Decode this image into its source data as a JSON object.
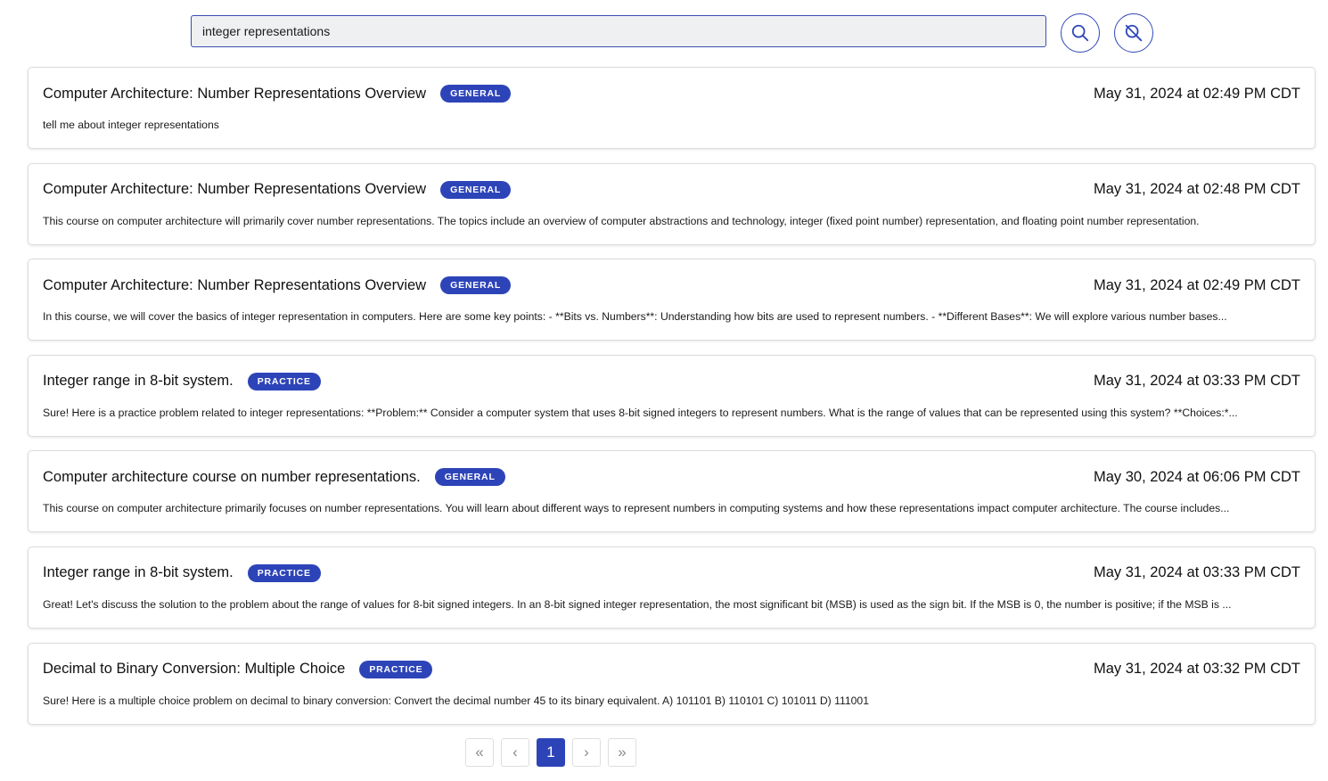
{
  "search": {
    "value": "integer representations"
  },
  "colors": {
    "accent": "#2d44b8",
    "input_bg": "#eff0f2",
    "card_border": "#dcdcdc"
  },
  "icons": {
    "search_button": "search-icon",
    "clear_button": "search-off-icon"
  },
  "results": [
    {
      "title": "Computer Architecture: Number Representations Overview",
      "badge": "GENERAL",
      "date": "May 31, 2024 at 02:49 PM CDT",
      "snippet": "tell me about integer representations"
    },
    {
      "title": "Computer Architecture: Number Representations Overview",
      "badge": "GENERAL",
      "date": "May 31, 2024 at 02:48 PM CDT",
      "snippet": "This course on computer architecture will primarily cover number representations. The topics include an overview of computer abstractions and technology, integer (fixed point number) representation, and floating point number representation."
    },
    {
      "title": "Computer Architecture: Number Representations Overview",
      "badge": "GENERAL",
      "date": "May 31, 2024 at 02:49 PM CDT",
      "snippet": "In this course, we will cover the basics of integer representation in computers. Here are some key points: - **Bits vs. Numbers**: Understanding how bits are used to represent numbers. - **Different Bases**: We will explore various number bases..."
    },
    {
      "title": "Integer range in 8-bit system.",
      "badge": "PRACTICE",
      "date": "May 31, 2024 at 03:33 PM CDT",
      "snippet": "Sure! Here is a practice problem related to integer representations: **Problem:** Consider a computer system that uses 8-bit signed integers to represent numbers. What is the range of values that can be represented using this system? **Choices:*..."
    },
    {
      "title": "Computer architecture course on number representations.",
      "badge": "GENERAL",
      "date": "May 30, 2024 at 06:06 PM CDT",
      "snippet": "This course on computer architecture primarily focuses on number representations. You will learn about different ways to represent numbers in computing systems and how these representations impact computer architecture. The course includes..."
    },
    {
      "title": "Integer range in 8-bit system.",
      "badge": "PRACTICE",
      "date": "May 31, 2024 at 03:33 PM CDT",
      "snippet": "Great! Let's discuss the solution to the problem about the range of values for 8-bit signed integers. In an 8-bit signed integer representation, the most significant bit (MSB) is used as the sign bit. If the MSB is 0, the number is positive; if the MSB is ..."
    },
    {
      "title": "Decimal to Binary Conversion: Multiple Choice",
      "badge": "PRACTICE",
      "date": "May 31, 2024 at 03:32 PM CDT",
      "snippet": "Sure! Here is a multiple choice problem on decimal to binary conversion: Convert the decimal number 45 to its binary equivalent. A) 101101 B) 110101 C) 101011 D) 111001"
    }
  ],
  "pagination": {
    "first": "«",
    "prev": "‹",
    "current_page": "1",
    "next": "›",
    "last": "»"
  }
}
